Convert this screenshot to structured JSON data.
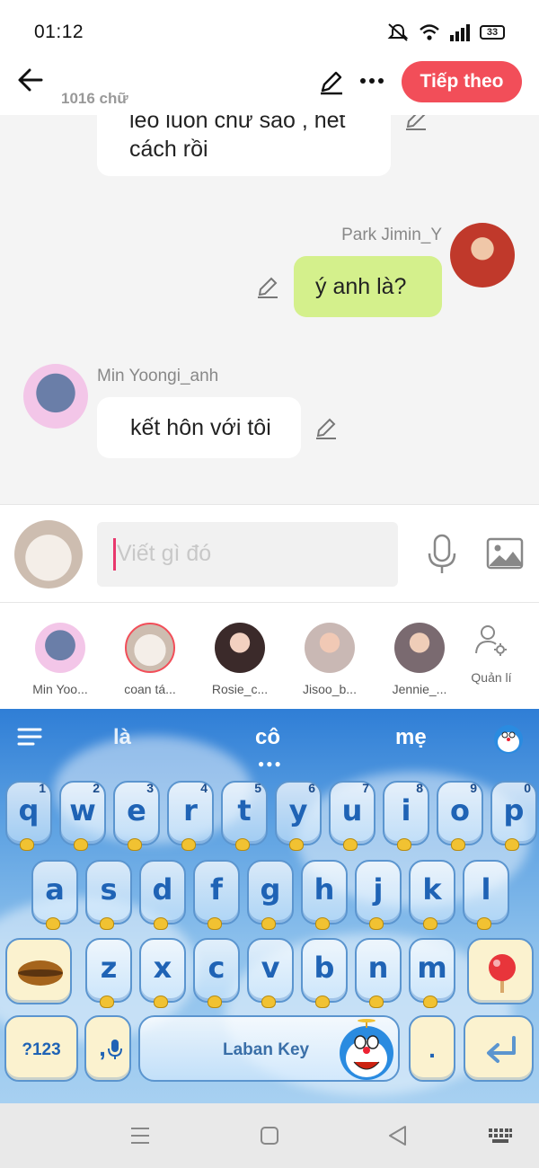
{
  "status_bar": {
    "time": "01:12",
    "battery": "33",
    "icons": [
      "mute-icon",
      "wifi-icon",
      "signal-icon",
      "battery-icon"
    ]
  },
  "header": {
    "word_count": "1016 chữ",
    "next_label": "Tiếp theo",
    "accent": "#f24e59"
  },
  "messages": [
    {
      "text_line1": "leo luôn chữ sao , hết",
      "text_line2": "cách rồi",
      "side": "left"
    },
    {
      "sender": "Park Jimin_Y",
      "text": "ý anh là?",
      "side": "right"
    },
    {
      "sender": "Min Yoongi_anh",
      "text": "kết hôn với tôi",
      "side": "left"
    }
  ],
  "composer": {
    "placeholder": "Viết gì đó"
  },
  "characters": [
    {
      "label": "Min Yoo...",
      "selected": false
    },
    {
      "label": "coan tá...",
      "selected": true
    },
    {
      "label": "Rosie_c...",
      "selected": false
    },
    {
      "label": "Jisoo_b...",
      "selected": false
    },
    {
      "label": "Jennie_...",
      "selected": false
    }
  ],
  "manage_label": "Quản lí",
  "keyboard": {
    "suggestions": [
      "là",
      "cô",
      "mẹ"
    ],
    "row1": [
      {
        "ch": "q",
        "num": "1"
      },
      {
        "ch": "w",
        "num": "2"
      },
      {
        "ch": "e",
        "num": "3"
      },
      {
        "ch": "r",
        "num": "4"
      },
      {
        "ch": "t",
        "num": "5"
      },
      {
        "ch": "y",
        "num": "6"
      },
      {
        "ch": "u",
        "num": "7"
      },
      {
        "ch": "i",
        "num": "8"
      },
      {
        "ch": "o",
        "num": "9"
      },
      {
        "ch": "p",
        "num": "0"
      }
    ],
    "row2": [
      "a",
      "s",
      "d",
      "f",
      "g",
      "h",
      "j",
      "k",
      "l"
    ],
    "row3": [
      "z",
      "x",
      "c",
      "v",
      "b",
      "n",
      "m"
    ],
    "symbols_label": "?123",
    "comma_label": ",",
    "space_label": "Laban Key",
    "period_label": "."
  }
}
